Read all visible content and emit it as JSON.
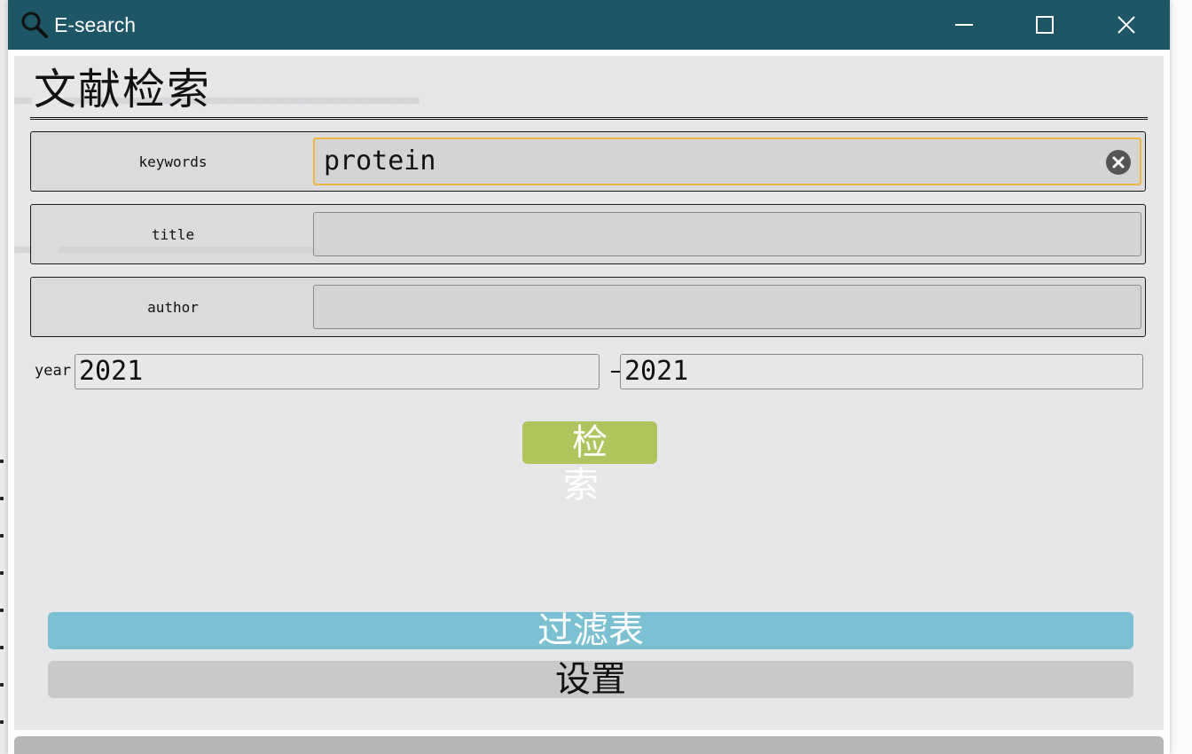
{
  "window": {
    "title": "E-search",
    "icons": {
      "app": "search-icon",
      "minimize": "minimize-icon",
      "maximize": "maximize-icon",
      "close": "close-icon"
    }
  },
  "form": {
    "heading": "文献检索",
    "fields": [
      {
        "label": "keywords",
        "value": "protein",
        "focused": true
      },
      {
        "label": "title",
        "value": ""
      },
      {
        "label": "author",
        "value": ""
      }
    ],
    "year": {
      "label": "year",
      "from": "2021",
      "to": "2021"
    },
    "search_button": "检 索"
  },
  "buttons": {
    "filter": "过滤表",
    "settings": "设置"
  },
  "colors": {
    "titlebar": "#1e5567",
    "focus_border": "#f0b240",
    "search_button": "#b0c45d",
    "filter_button": "#7bc0d2",
    "settings_button": "#c9c8ca"
  }
}
